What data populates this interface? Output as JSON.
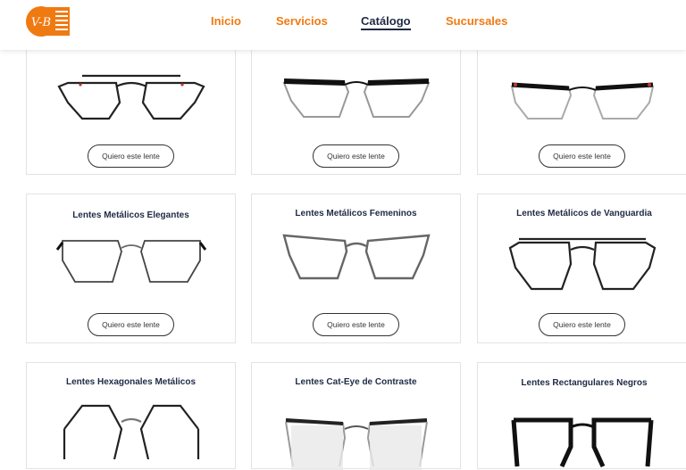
{
  "brand": {
    "logo_text": "V-B",
    "accent": "#f07a12",
    "navy": "#1f2a44"
  },
  "nav": {
    "items": [
      {
        "label": "Inicio",
        "active": false
      },
      {
        "label": "Servicios",
        "active": false
      },
      {
        "label": "Catálogo",
        "active": true
      },
      {
        "label": "Sucursales",
        "active": false
      }
    ]
  },
  "cta_label": "Quiero este lente",
  "products": [
    {
      "title": "",
      "frame": "aviator-metal"
    },
    {
      "title": "",
      "frame": "browline-black"
    },
    {
      "title": "",
      "frame": "browline-silver"
    },
    {
      "title": "Lentes Metálicos Elegantes",
      "frame": "geometric-thin"
    },
    {
      "title": "Lentes Metálicos Femeninos",
      "frame": "cateye-silver"
    },
    {
      "title": "Lentes Metálicos de Vanguardia",
      "frame": "aviator-black"
    },
    {
      "title": "Lentes Hexagonales Metálicos",
      "frame": "hexagonal"
    },
    {
      "title": "Lentes Cat-Eye de Contraste",
      "frame": "cateye-contrast"
    },
    {
      "title": "Lentes Rectangulares Negros",
      "frame": "rectangular-black"
    }
  ]
}
